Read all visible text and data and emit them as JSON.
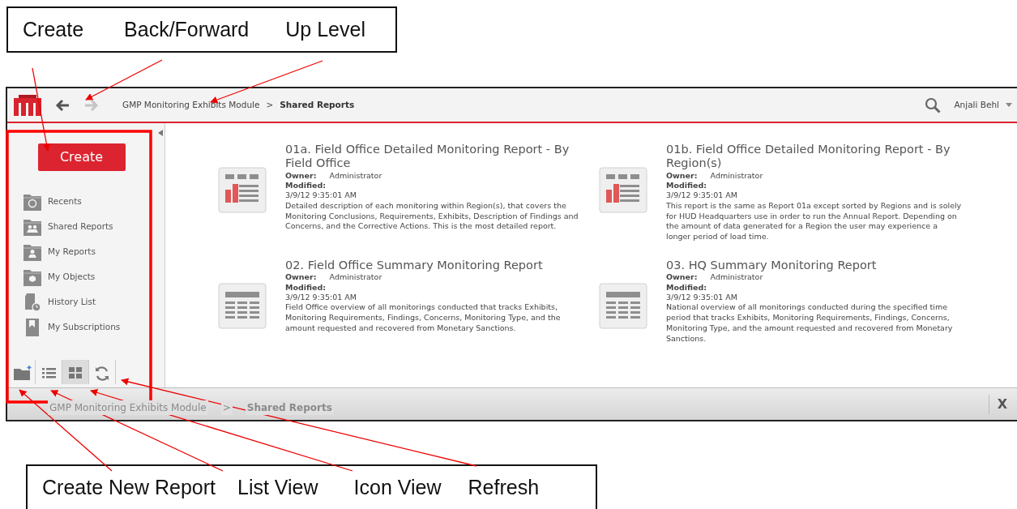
{
  "callouts_top": [
    {
      "label": "Create"
    },
    {
      "label": "Back/Forward"
    },
    {
      "label": "Up Level"
    }
  ],
  "window": {
    "toolbar": {
      "nav": [
        {
          "kind": "back",
          "disabled": false
        },
        {
          "kind": "forward",
          "disabled": true
        }
      ],
      "breadcrumb": [
        "GMP Monitoring Exhibits Module",
        ">",
        "Shared Reports"
      ],
      "user": "Anjali Behl"
    },
    "sidebar": {
      "create_button": "Create",
      "items": [
        {
          "kind": "recents",
          "label": "Recents"
        },
        {
          "kind": "shared",
          "label": "Shared Reports"
        },
        {
          "kind": "mine",
          "label": "My Reports"
        },
        {
          "kind": "objects",
          "label": "My Objects"
        },
        {
          "kind": "history",
          "label": "History List"
        },
        {
          "kind": "subscriptions",
          "label": "My Subscriptions"
        }
      ],
      "tools": [
        {
          "kind": "new",
          "selected": false
        },
        {
          "kind": "list",
          "selected": false
        },
        {
          "kind": "icons",
          "selected": true
        },
        {
          "kind": "refresh",
          "selected": false
        }
      ]
    },
    "reports": [
      {
        "kind": "chart",
        "title": "01a.  Field Office Detailed Monitoring Report - By Field Office",
        "owner_label": "Owner:",
        "owner": "Administrator",
        "modified_label": "Modified:",
        "modified": "3/9/12 9:35:01 AM",
        "description": "Detailed description of each monitoring within Region(s), that covers the Monitoring Conclusions, Requirements, Exhibits, Description of Findings and Concerns, and the Corrective Actions. This is the most detailed report."
      },
      {
        "kind": "chart",
        "title": "01b.  Field Office Detailed Monitoring Report - By Region(s)",
        "owner_label": "Owner:",
        "owner": "Administrator",
        "modified_label": "Modified:",
        "modified": "3/9/12 9:35:01 AM",
        "description": "This report is the same as Report 01a except sorted by Regions and is solely for HUD Headquarters use in order to run the Annual Report. Depending on the amount of data generated for a Region the user may experience a longer period of load time."
      },
      {
        "kind": "table",
        "title": "02.  Field Office Summary Monitoring Report",
        "owner_label": "Owner:",
        "owner": "Administrator",
        "modified_label": "Modified:",
        "modified": "3/9/12 9:35:01 AM",
        "description": "Field Office overview of all monitorings conducted that tracks Exhibits, Monitoring Requirements, Findings, Concerns, Monitoring Type, and the amount requested and recovered from Monetary Sanctions."
      },
      {
        "kind": "table",
        "title": "03.  HQ Summary Monitoring Report",
        "owner_label": "Owner:",
        "owner": "Administrator",
        "modified_label": "Modified:",
        "modified": "3/9/12 9:35:01 AM",
        "description": "National overview of all monitorings conducted during the specified time period that tracks Exhibits, Monitoring Requirements, Findings, Concerns, Monitoring Type, and the amount requested and recovered from Monetary Sanctions."
      }
    ],
    "status_bar": {
      "breadcrumb": [
        "GMP Monitoring Exhibits Module",
        ">",
        "Shared Reports"
      ],
      "close": "X"
    }
  },
  "callouts_bottom": [
    {
      "label": "Create New Report"
    },
    {
      "label": "List View"
    },
    {
      "label": "Icon View"
    },
    {
      "label": "Refresh"
    }
  ]
}
